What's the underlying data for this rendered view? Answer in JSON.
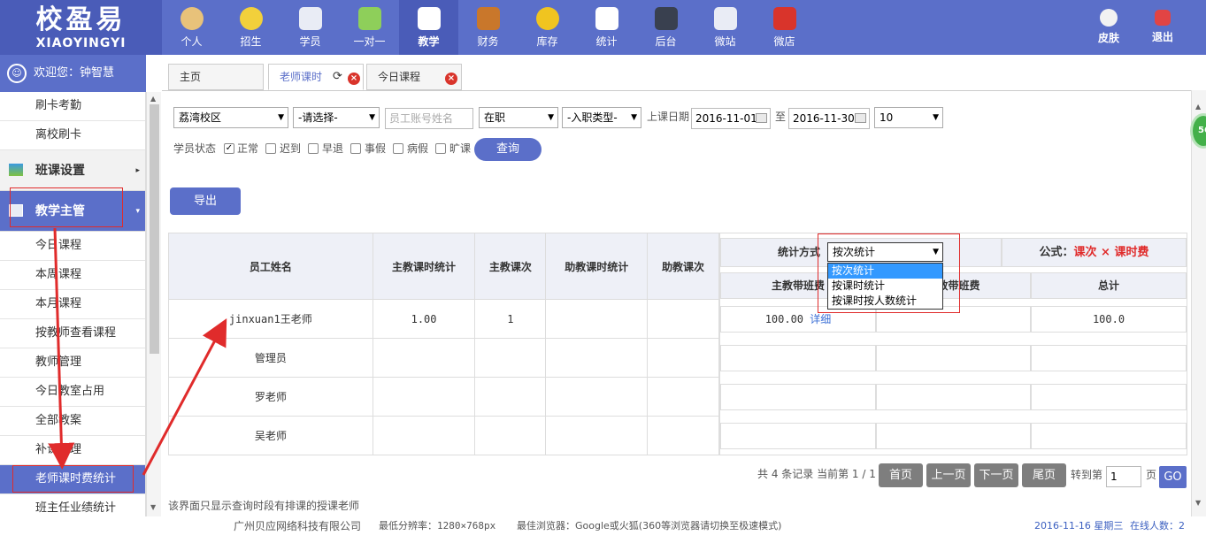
{
  "logo": {
    "cn": "校盈易",
    "en": "XIAOYINGYI"
  },
  "nav": [
    {
      "label": "个人",
      "icon": "person-icon",
      "color": "#e8c27a"
    },
    {
      "label": "招生",
      "icon": "magnifier-icon",
      "color": "#f2d03b"
    },
    {
      "label": "学员",
      "icon": "student-icon",
      "color": "#e9ecf5"
    },
    {
      "label": "一对一",
      "icon": "chat-icon",
      "color": "#8ecf5a"
    },
    {
      "label": "教学",
      "icon": "pencil-icon",
      "color": "#ffffff"
    },
    {
      "label": "财务",
      "icon": "briefcase-icon",
      "color": "#c9772b"
    },
    {
      "label": "库存",
      "icon": "piechart-icon",
      "color": "#f0c420"
    },
    {
      "label": "统计",
      "icon": "barchart-icon",
      "color": "#ffffff"
    },
    {
      "label": "后台",
      "icon": "monitor-icon",
      "color": "#39404f"
    },
    {
      "label": "微站",
      "icon": "webpage-icon",
      "color": "#e9ecf5"
    },
    {
      "label": "微店",
      "icon": "shop-icon",
      "color": "#d9342b"
    }
  ],
  "topright": {
    "skin": "皮肤",
    "logout": "退出"
  },
  "welcome": "欢迎您：钟智慧",
  "sidebar": {
    "items_top": [
      "刷卡考勤",
      "离校刷卡"
    ],
    "group1": "班课设置",
    "group2": "教学主管",
    "items": [
      "今日课程",
      "本周课程",
      "本月课程",
      "按教师查看课程",
      "教师管理",
      "今日教室占用",
      "全部教案",
      "补课管理",
      "老师课时费统计",
      "班主任业绩统计"
    ]
  },
  "tabs": [
    {
      "label": "主页"
    },
    {
      "label": "老师课时"
    },
    {
      "label": "今日课程"
    }
  ],
  "filters": {
    "campus": "荔湾校区",
    "select1": "-请选择-",
    "account_placeholder": "员工账号姓名",
    "status": "在职",
    "job_type": "-入职类型-",
    "date_label": "上课日期",
    "date_from": "2016-11-01",
    "to": "至",
    "date_to": "2016-11-30",
    "page_size": "10",
    "student_state_label": "学员状态",
    "states": [
      {
        "label": "正常",
        "checked": true
      },
      {
        "label": "迟到",
        "checked": false
      },
      {
        "label": "早退",
        "checked": false
      },
      {
        "label": "事假",
        "checked": false
      },
      {
        "label": "病假",
        "checked": false
      },
      {
        "label": "旷课",
        "checked": false
      }
    ],
    "query": "查询"
  },
  "export": "导出",
  "table": {
    "headers": [
      "员工姓名",
      "主教课时统计",
      "主教课次",
      "助教课时统计",
      "助教课次"
    ],
    "rows": [
      [
        "jinxuan1王老师",
        "1.00",
        "1",
        "",
        ""
      ],
      [
        "管理员",
        "",
        "",
        "",
        ""
      ],
      [
        "罗老师",
        "",
        "",
        "",
        ""
      ],
      [
        "吴老师",
        "",
        "",
        "",
        ""
      ]
    ]
  },
  "rpanel": {
    "method_label": "统计方式",
    "method_value": "按次统计",
    "options": [
      "按次统计",
      "按课时统计",
      "按课时按人数统计"
    ],
    "formula_label": "公式：",
    "formula": "课次 × 课时费",
    "col1": "主教带班费",
    "col2": "助教带班费",
    "col3": "总计",
    "row1": {
      "v1": "100.00",
      "detail": "详细",
      "total": "100.0"
    }
  },
  "pager": {
    "info": "共 4 条记录 当前第 1 / 1",
    "first": "首页",
    "prev": "上一页",
    "next": "下一页",
    "last": "尾页",
    "goto": "转到第",
    "page": "1",
    "page_unit": "页",
    "go": "GO"
  },
  "note": "该界面只显示查询时段有排课的授课老师",
  "footer": {
    "company": "广州贝应网络科技有限公司",
    "resolution": "最低分辨率：1280×768px",
    "browser": "最佳浏览器：Google或火狐(360等浏览器请切换至极速模式)",
    "date": "2016-11-16 星期三",
    "online": "在线人数：2"
  },
  "badge": "56",
  "colors": {
    "primary": "#5b6fc9",
    "red": "#e02b2b",
    "gray_btn": "#7e7e7e"
  }
}
